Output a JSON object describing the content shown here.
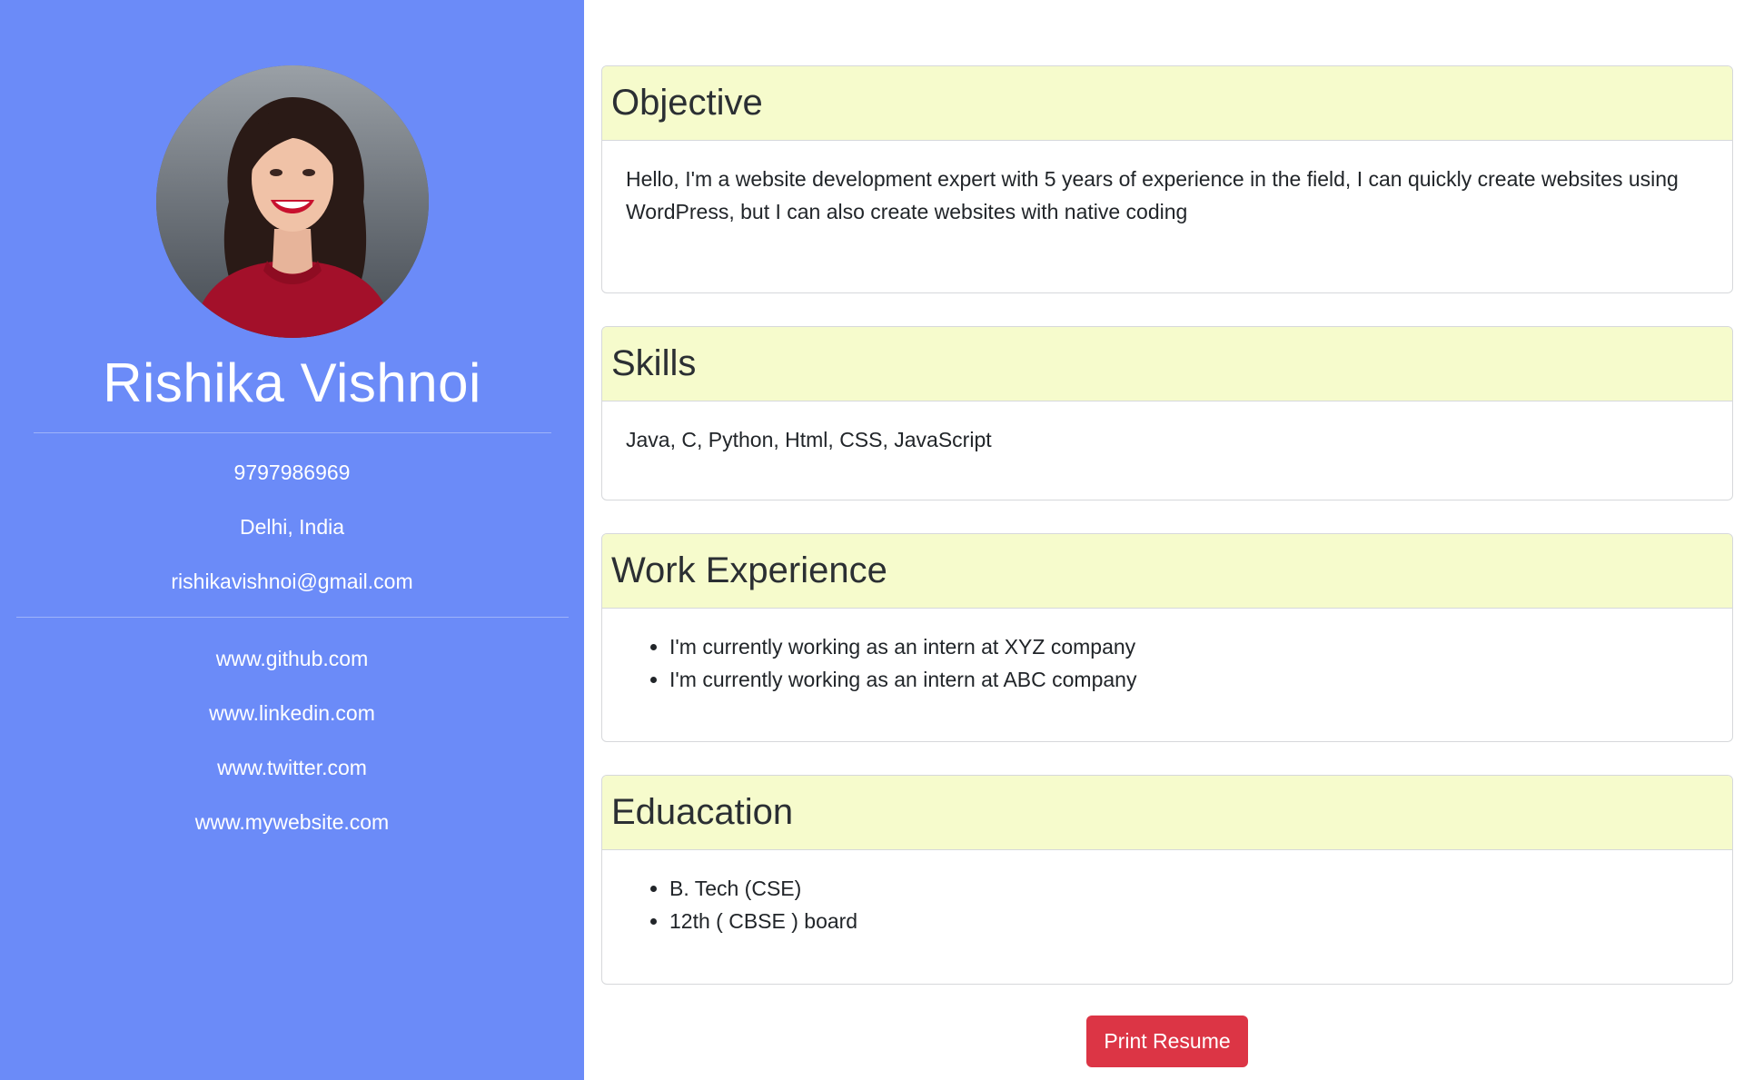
{
  "profile": {
    "name": "Rishika Vishnoi",
    "phone": "9797986969",
    "location": "Delhi, India",
    "email": "rishikavishnoi@gmail.com"
  },
  "links": [
    {
      "label": "www.github.com"
    },
    {
      "label": "www.linkedin.com"
    },
    {
      "label": "www.twitter.com"
    },
    {
      "label": "www.mywebsite.com"
    }
  ],
  "sections": {
    "objective": {
      "title": "Objective",
      "text": "Hello, I'm a website development expert with 5 years of experience in the field, I can quickly create websites using WordPress, but I can also create websites with native coding"
    },
    "skills": {
      "title": "Skills",
      "text": "Java, C, Python, Html, CSS, JavaScript"
    },
    "work": {
      "title": "Work Experience",
      "items": [
        "I'm currently working as an intern at XYZ company",
        "I'm currently working as an intern at ABC company"
      ]
    },
    "education": {
      "title": "Eduacation",
      "items": [
        "B. Tech (CSE)",
        "12th ( CBSE ) board"
      ]
    }
  },
  "actions": {
    "print_label": "Print Resume"
  },
  "colors": {
    "sidebar_bg": "#6b8bf8",
    "card_header_bg": "#f6fbcc",
    "print_button_bg": "#dc3545"
  }
}
